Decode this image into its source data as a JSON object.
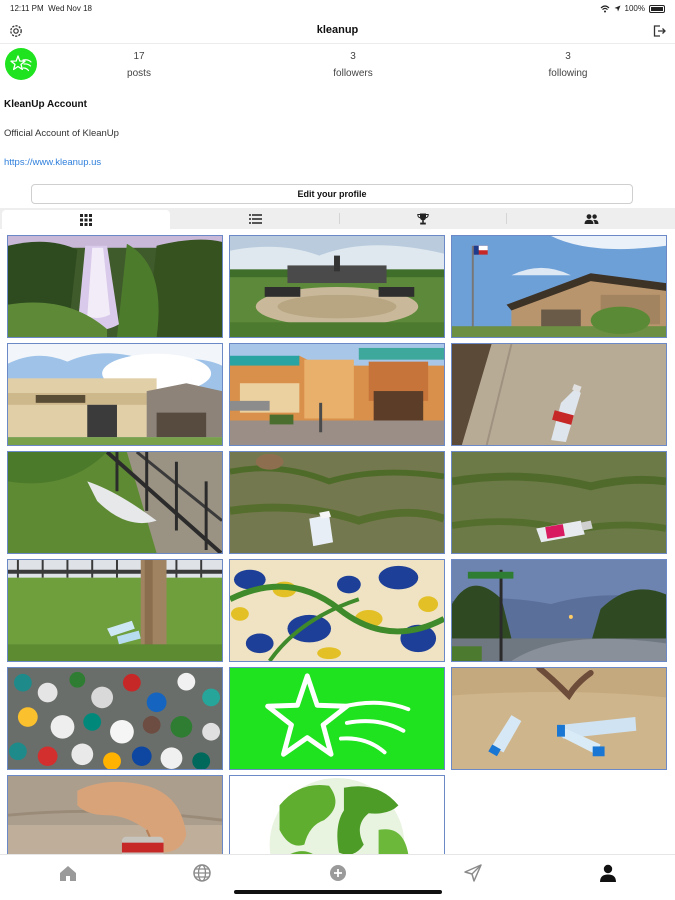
{
  "status_bar": {
    "time": "12:11 PM",
    "date": "Wed Nov 18",
    "battery": "100%"
  },
  "header": {
    "title": "kleanup",
    "settings_icon": "gear-icon",
    "logout_icon": "logout-icon"
  },
  "profile": {
    "stats": [
      {
        "count": "17",
        "label": "posts"
      },
      {
        "count": "3",
        "label": "followers"
      },
      {
        "count": "3",
        "label": "following"
      }
    ],
    "name": "KleanUp Account",
    "bio": "Official Account of KleanUp",
    "link": "https://www.kleanup.us",
    "edit_button": "Edit your profile"
  },
  "tabs": [
    {
      "icon": "grid-icon",
      "active": true
    },
    {
      "icon": "list-icon",
      "active": false
    },
    {
      "icon": "trophy-icon",
      "active": false
    },
    {
      "icon": "people-icon",
      "active": false
    }
  ],
  "posts": [
    "waterfall",
    "memorial-plaza",
    "school-building-with-flag",
    "cottonwood-creek-school",
    "outlet-shopping-center",
    "plastic-bottle-on-curb",
    "litter-by-fence",
    "can-in-grass",
    "bottle-in-grass",
    "bottles-under-tree",
    "patterned-fabric",
    "evening-street",
    "pile-of-plastic-caps",
    "kleanup-logo",
    "bottles-on-sand",
    "hand-picking-can",
    "green-globe"
  ],
  "bottom_nav": [
    "home-icon",
    "globe-icon",
    "add-icon",
    "send-icon",
    "profile-icon"
  ]
}
